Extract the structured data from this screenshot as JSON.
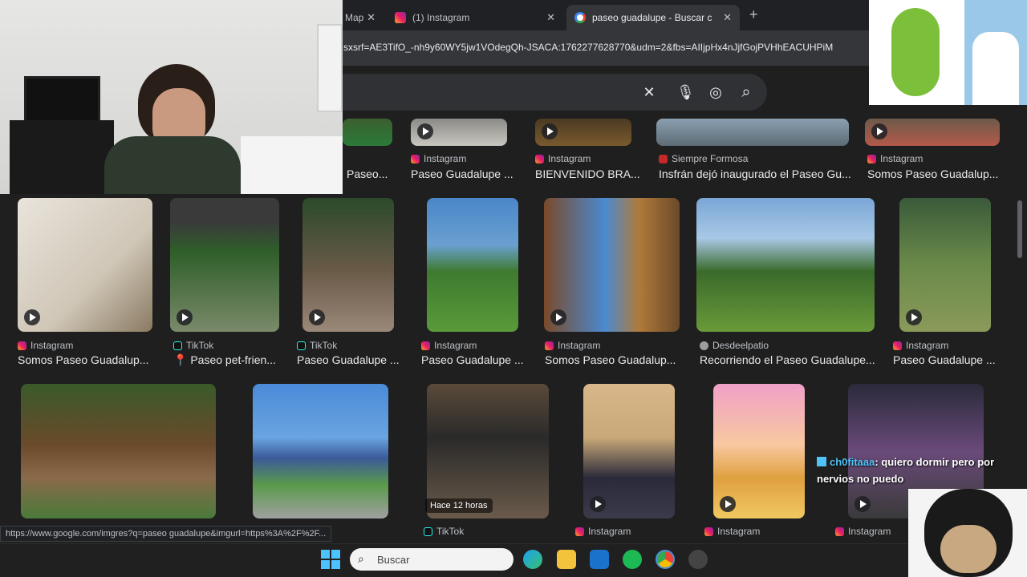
{
  "tabs": [
    {
      "label": "Map",
      "close": "✕"
    },
    {
      "label": "(1) Instagram",
      "close": "✕"
    },
    {
      "label": "paseo guadalupe - Buscar con G",
      "close": "✕"
    }
  ],
  "new_tab": "+",
  "address_url": "sxsrf=AE3TifO_-nh9y60WY5jw1VOdegQh-JSACA:1762277628770&udm=2&fbs=AIIjpHx4nJjfGojPVHhEACUHPiM",
  "search": {
    "clear": "✕",
    "mic": "🎙",
    "lens": "◎",
    "go": "⌕"
  },
  "row1": [
    {
      "source": "",
      "title": "Paseo..."
    },
    {
      "source": "Instagram",
      "title": "Paseo Guadalupe ..."
    },
    {
      "source": "Instagram",
      "title": "BIENVENIDO BRA..."
    },
    {
      "source": "Siempre Formosa",
      "title": "Insfrán dejó inaugurado el Paseo Gu..."
    },
    {
      "source": "Instagram",
      "title": "Somos Paseo Guadalup..."
    }
  ],
  "row2": [
    {
      "source": "Instagram",
      "title": "Somos Paseo Guadalup..."
    },
    {
      "source": "TikTok",
      "title": "📍 Paseo pet-frien..."
    },
    {
      "source": "TikTok",
      "title": "Paseo Guadalupe ..."
    },
    {
      "source": "Instagram",
      "title": "Paseo Guadalupe ..."
    },
    {
      "source": "Instagram",
      "title": "Somos Paseo Guadalup..."
    },
    {
      "source": "Desdeelpatio",
      "title": "Recorriendo el Paseo Guadalupe..."
    },
    {
      "source": "Instagram",
      "title": "Paseo Guadalupe ..."
    }
  ],
  "row3": [
    {
      "source": ""
    },
    {
      "source": ""
    },
    {
      "source": "TikTok",
      "badge": "Hace 12 horas"
    },
    {
      "source": "Instagram"
    },
    {
      "source": "Instagram"
    },
    {
      "source": "Instagram"
    }
  ],
  "status_url": "https://www.google.com/imgres?q=paseo guadalupe&imgurl=https%3A%2F%2F...",
  "taskbar": {
    "search_label": "Buscar"
  },
  "chat": {
    "user": "ch0fitaaa",
    "message": ": quiero dormir pero por nervios no puedo"
  }
}
